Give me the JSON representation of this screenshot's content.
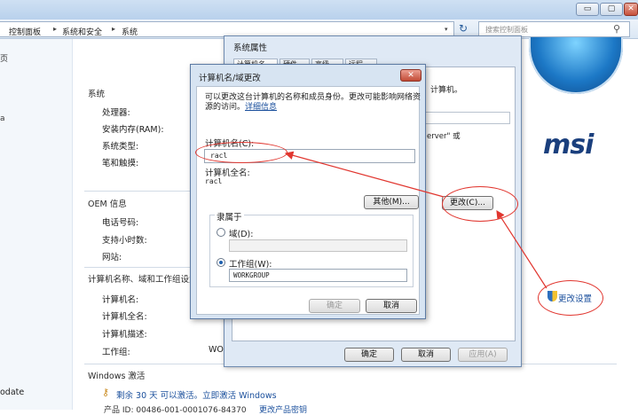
{
  "window": {
    "min_glyph": "▭",
    "max_glyph": "▢",
    "close_glyph": "✕"
  },
  "address_bar": {
    "crumbs": [
      "控制面板",
      "系统和安全",
      "系统"
    ],
    "separator": "▸",
    "dropdown_glyph": "▾",
    "refresh_glyph": "↻",
    "search_placeholder": "搜索控制面板",
    "search_glyph": "⚲"
  },
  "left_nav": {
    "partial_glyphs": [
      "页",
      "a"
    ],
    "bottom_text": "odate"
  },
  "system_info": {
    "system_heading": "系统",
    "processor": "处理器:",
    "ram": "安装内存(RAM):",
    "system_type": "系统类型:",
    "pen_touch": "笔和触摸:",
    "oem_heading": "OEM 信息",
    "phone": "电话号码:",
    "support_hours": "支持小时数:",
    "website": "网站:",
    "naming_heading": "计算机名称、域和工作组设置",
    "computer_name": "计算机名:",
    "full_name": "计算机全名:",
    "description": "计算机描述:",
    "workgroup": "工作组:",
    "workgroup_value_partial": "WO",
    "change_settings": "更改设置",
    "activation_heading": "Windows 激活",
    "activation_text": "剩余 30 天 可以激活。立即激活 Windows",
    "product_id": "产品 ID: 00486-001-0001076-84370",
    "product_key_link": "更改产品密钥",
    "brand_logo": "msi"
  },
  "sysprop_dialog": {
    "title": "系统属性",
    "tabs": [
      "计算机名",
      "硬件",
      "高级",
      "远程"
    ],
    "desc_partial": "计算机。",
    "server_text_partial": "erver\" 或",
    "change_button": "更改(C)...",
    "ok": "确定",
    "cancel": "取消",
    "apply": "应用(A)"
  },
  "computer_name_dialog": {
    "title": "计算机名/域更改",
    "close_glyph": "✕",
    "desc": "可以更改这台计算机的名称和成员身份。更改可能影响网络资源的访问。",
    "help_link": "详细信息",
    "name_label": "计算机名(C):",
    "name_value": "racl",
    "full_name_label": "计算机全名:",
    "full_name_value": "racl",
    "other_button": "其他(M)...",
    "member_of_label": "隶属于",
    "domain_label": "域(D):",
    "domain_value": "",
    "workgroup_label": "工作组(W):",
    "workgroup_value": "WORKGROUP",
    "workgroup_selected": true,
    "ok": "确定",
    "cancel": "取消"
  },
  "colors": {
    "annotation_red": "#e1362f",
    "link_blue": "#1a4f9c",
    "dialog_frame": "#d7e4f2"
  }
}
